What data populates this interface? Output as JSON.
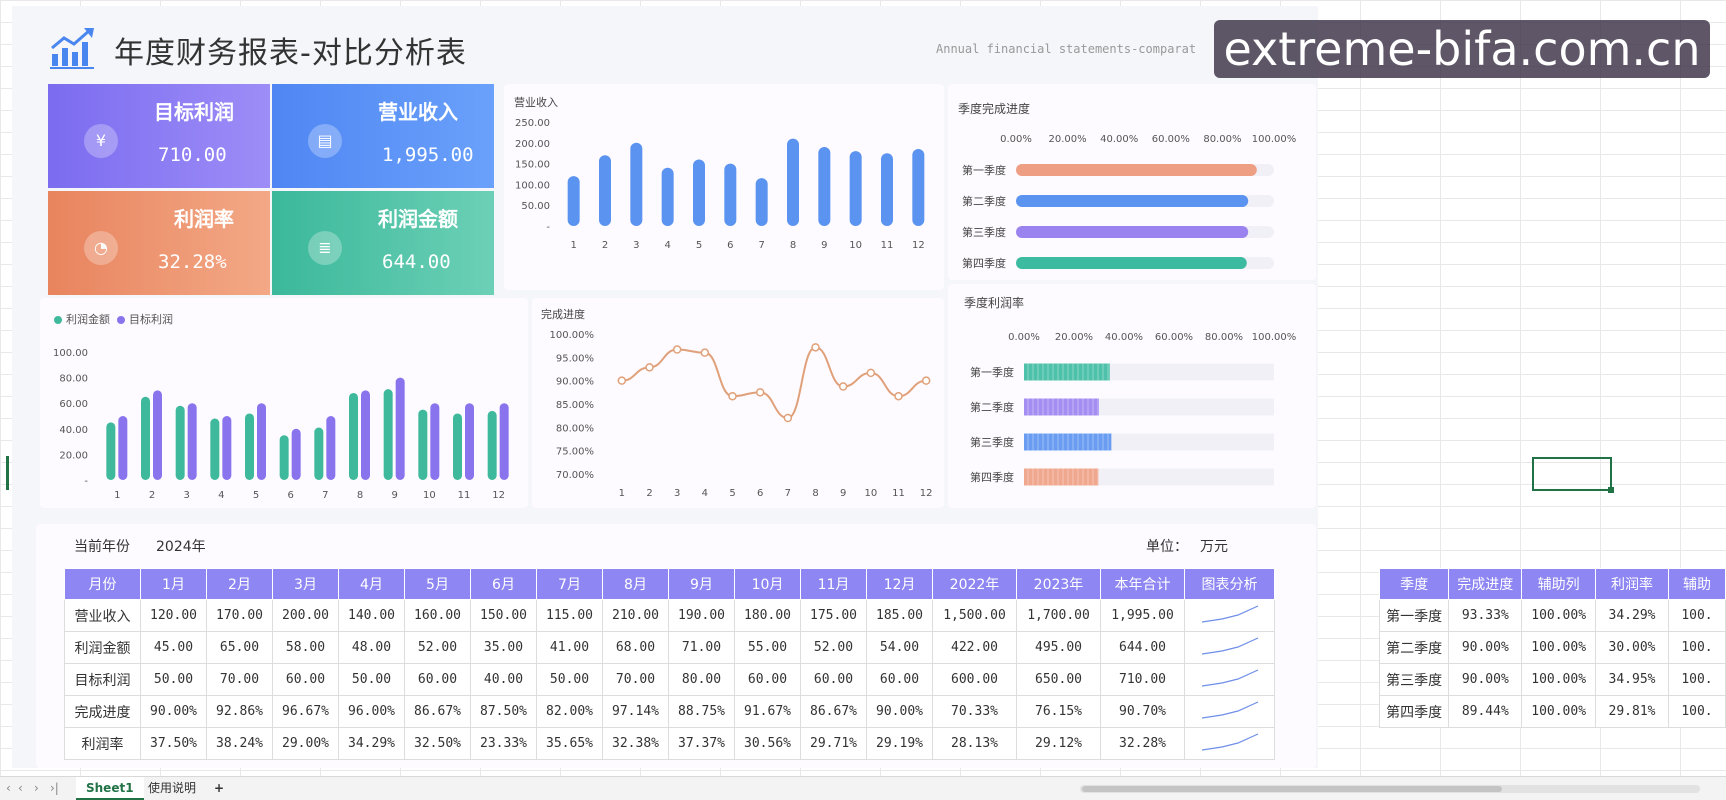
{
  "header": {
    "title": "年度财务报表-对比分析表",
    "subtitle": "Annual financial statements-comparat",
    "watermark": "extreme-bifa.com.cn"
  },
  "kpis": [
    {
      "label": "目标利润",
      "value": "710.00",
      "icon": "money-icon"
    },
    {
      "label": "营业收入",
      "value": "1,995.00",
      "icon": "document-icon"
    },
    {
      "label": "利润率",
      "value": "32.28%",
      "icon": "pie-icon"
    },
    {
      "label": "利润金额",
      "value": "644.00",
      "icon": "database-icon"
    }
  ],
  "chart_data": [
    {
      "type": "bar",
      "title": "营业收入",
      "categories": [
        "1",
        "2",
        "3",
        "4",
        "5",
        "6",
        "7",
        "8",
        "9",
        "10",
        "11",
        "12"
      ],
      "values": [
        120,
        170,
        200,
        140,
        160,
        150,
        115,
        210,
        190,
        180,
        175,
        185
      ],
      "yticks": [
        "-",
        "50.00",
        "100.00",
        "150.00",
        "200.00",
        "250.00"
      ],
      "ylim": [
        0,
        250
      ],
      "color": "#5b93f0"
    },
    {
      "type": "bar",
      "title": "",
      "categories": [
        "1",
        "2",
        "3",
        "4",
        "5",
        "6",
        "7",
        "8",
        "9",
        "10",
        "11",
        "12"
      ],
      "series": [
        {
          "name": "利润金额",
          "values": [
            45,
            65,
            58,
            48,
            52,
            35,
            41,
            68,
            71,
            55,
            52,
            54
          ],
          "color": "#3fb99c"
        },
        {
          "name": "目标利润",
          "values": [
            50,
            70,
            60,
            50,
            60,
            40,
            50,
            70,
            80,
            60,
            60,
            60
          ],
          "color": "#8a74ee"
        }
      ],
      "yticks": [
        "-",
        "20.00",
        "40.00",
        "60.00",
        "80.00",
        "100.00"
      ],
      "ylim": [
        0,
        100
      ],
      "legend": "top-left"
    },
    {
      "type": "line",
      "title": "完成进度",
      "categories": [
        "1",
        "2",
        "3",
        "4",
        "5",
        "6",
        "7",
        "8",
        "9",
        "10",
        "11",
        "12"
      ],
      "values": [
        90.0,
        92.86,
        96.67,
        96.0,
        86.67,
        87.5,
        82.0,
        97.14,
        88.75,
        91.67,
        86.67,
        90.0
      ],
      "yticks": [
        "70.00%",
        "75.00%",
        "80.00%",
        "85.00%",
        "90.00%",
        "95.00%",
        "100.00%"
      ],
      "ylim": [
        70,
        100
      ],
      "color": "#e0a07a"
    },
    {
      "type": "bar",
      "orientation": "horizontal",
      "title": "季度完成进度",
      "categories": [
        "第一季度",
        "第二季度",
        "第三季度",
        "第四季度"
      ],
      "values": [
        93.33,
        90.0,
        90.0,
        89.44
      ],
      "colors": [
        "#ee9e82",
        "#5b93f0",
        "#9b83ef",
        "#3cbba1"
      ],
      "xticks": [
        "0.00%",
        "20.00%",
        "40.00%",
        "60.00%",
        "80.00%",
        "100.00%"
      ],
      "xlim": [
        0,
        100
      ]
    },
    {
      "type": "bar",
      "orientation": "horizontal",
      "title": "季度利润率",
      "categories": [
        "第一季度",
        "第二季度",
        "第三季度",
        "第四季度"
      ],
      "values": [
        34.29,
        30.0,
        34.95,
        29.81
      ],
      "colors": [
        "#3cbba1",
        "#9b83ef",
        "#5b93f0",
        "#ee9e82"
      ],
      "xticks": [
        "0.00%",
        "20.00%",
        "40.00%",
        "60.00%",
        "80.00%",
        "100.00%"
      ],
      "xlim": [
        0,
        100
      ]
    }
  ],
  "table": {
    "year_label": "当前年份",
    "year": "2024年",
    "unit_label": "单位：",
    "unit": "万元",
    "headers": [
      "月份",
      "1月",
      "2月",
      "3月",
      "4月",
      "5月",
      "6月",
      "7月",
      "8月",
      "9月",
      "10月",
      "11月",
      "12月",
      "2022年",
      "2023年",
      "本年合计",
      "图表分析"
    ],
    "rows": [
      {
        "label": "营业收入",
        "cells": [
          "120.00",
          "170.00",
          "200.00",
          "140.00",
          "160.00",
          "150.00",
          "115.00",
          "210.00",
          "190.00",
          "180.00",
          "175.00",
          "185.00",
          "1,500.00",
          "1,700.00",
          "1,995.00"
        ]
      },
      {
        "label": "利润金额",
        "cells": [
          "45.00",
          "65.00",
          "58.00",
          "48.00",
          "52.00",
          "35.00",
          "41.00",
          "68.00",
          "71.00",
          "55.00",
          "52.00",
          "54.00",
          "422.00",
          "495.00",
          "644.00"
        ]
      },
      {
        "label": "目标利润",
        "cells": [
          "50.00",
          "70.00",
          "60.00",
          "50.00",
          "60.00",
          "40.00",
          "50.00",
          "70.00",
          "80.00",
          "60.00",
          "60.00",
          "60.00",
          "600.00",
          "650.00",
          "710.00"
        ]
      },
      {
        "label": "完成进度",
        "cells": [
          "90.00%",
          "92.86%",
          "96.67%",
          "96.00%",
          "86.67%",
          "87.50%",
          "82.00%",
          "97.14%",
          "88.75%",
          "91.67%",
          "86.67%",
          "90.00%",
          "70.33%",
          "76.15%",
          "90.70%"
        ]
      },
      {
        "label": "利润率",
        "cells": [
          "37.50%",
          "38.24%",
          "29.00%",
          "34.29%",
          "32.50%",
          "23.33%",
          "35.65%",
          "32.38%",
          "37.37%",
          "30.56%",
          "29.71%",
          "29.19%",
          "28.13%",
          "29.12%",
          "32.28%"
        ]
      }
    ]
  },
  "side_table": {
    "headers": [
      "季度",
      "完成进度",
      "辅助列",
      "利润率",
      "辅助"
    ],
    "rows": [
      {
        "label": "第一季度",
        "cells": [
          "93.33%",
          "100.00%",
          "34.29%",
          "100."
        ]
      },
      {
        "label": "第二季度",
        "cells": [
          "90.00%",
          "100.00%",
          "30.00%",
          "100."
        ]
      },
      {
        "label": "第三季度",
        "cells": [
          "90.00%",
          "100.00%",
          "34.95%",
          "100."
        ]
      },
      {
        "label": "第四季度",
        "cells": [
          "89.44%",
          "100.00%",
          "29.81%",
          "100."
        ]
      }
    ]
  },
  "tabs": {
    "sheet1": "Sheet1",
    "sheet2": "使用说明",
    "add": "+"
  }
}
